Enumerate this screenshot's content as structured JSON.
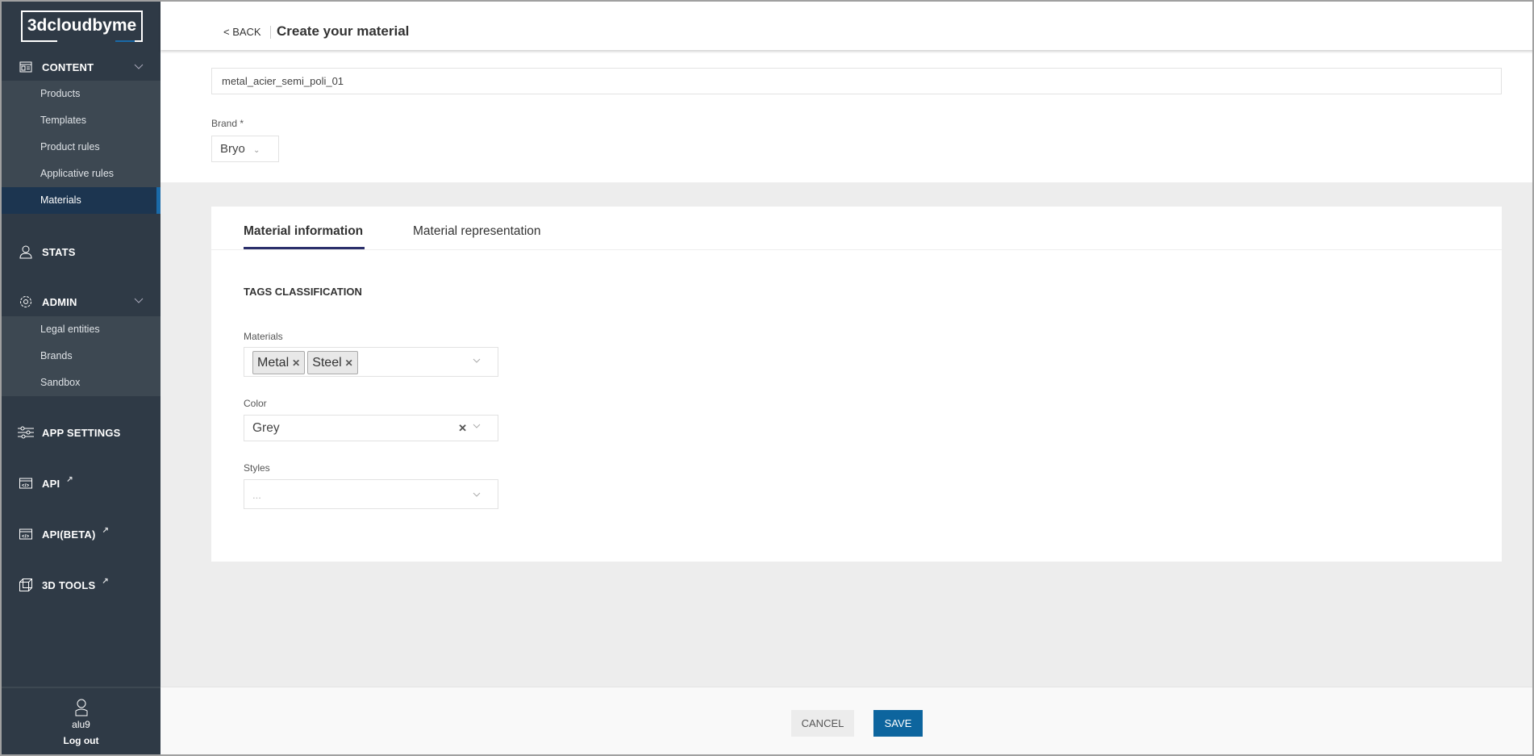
{
  "brand": {
    "logo_text": "3dcloudbyme",
    "accent": "#1a6aa8"
  },
  "sidebar": {
    "content": {
      "label": "CONTENT",
      "items": [
        "Products",
        "Templates",
        "Product rules",
        "Applicative rules",
        "Materials"
      ],
      "active": "Materials"
    },
    "stats": {
      "label": "STATS"
    },
    "admin": {
      "label": "ADMIN",
      "items": [
        "Legal entities",
        "Brands",
        "Sandbox"
      ]
    },
    "app_settings": {
      "label": "APP SETTINGS"
    },
    "api": {
      "label": "API"
    },
    "api_beta": {
      "label": "API(BETA)"
    },
    "tools": {
      "label": "3D TOOLS"
    },
    "user": {
      "name": "alu9",
      "logout": "Log out"
    }
  },
  "header": {
    "back": "< BACK",
    "title": "Create your material"
  },
  "form": {
    "name_value": "metal_acier_semi_poli_01",
    "brand_label": "Brand *",
    "brand_value": "Bryo"
  },
  "tabs": [
    {
      "label": "Material information",
      "active": true
    },
    {
      "label": "Material representation",
      "active": false
    }
  ],
  "tags": {
    "heading": "TAGS CLASSIFICATION",
    "materials_label": "Materials",
    "materials_values": [
      "Metal",
      "Steel"
    ],
    "color_label": "Color",
    "color_value": "Grey",
    "styles_label": "Styles",
    "styles_placeholder": "..."
  },
  "footer": {
    "cancel": "CANCEL",
    "save": "SAVE",
    "save_color": "#0d659e"
  }
}
